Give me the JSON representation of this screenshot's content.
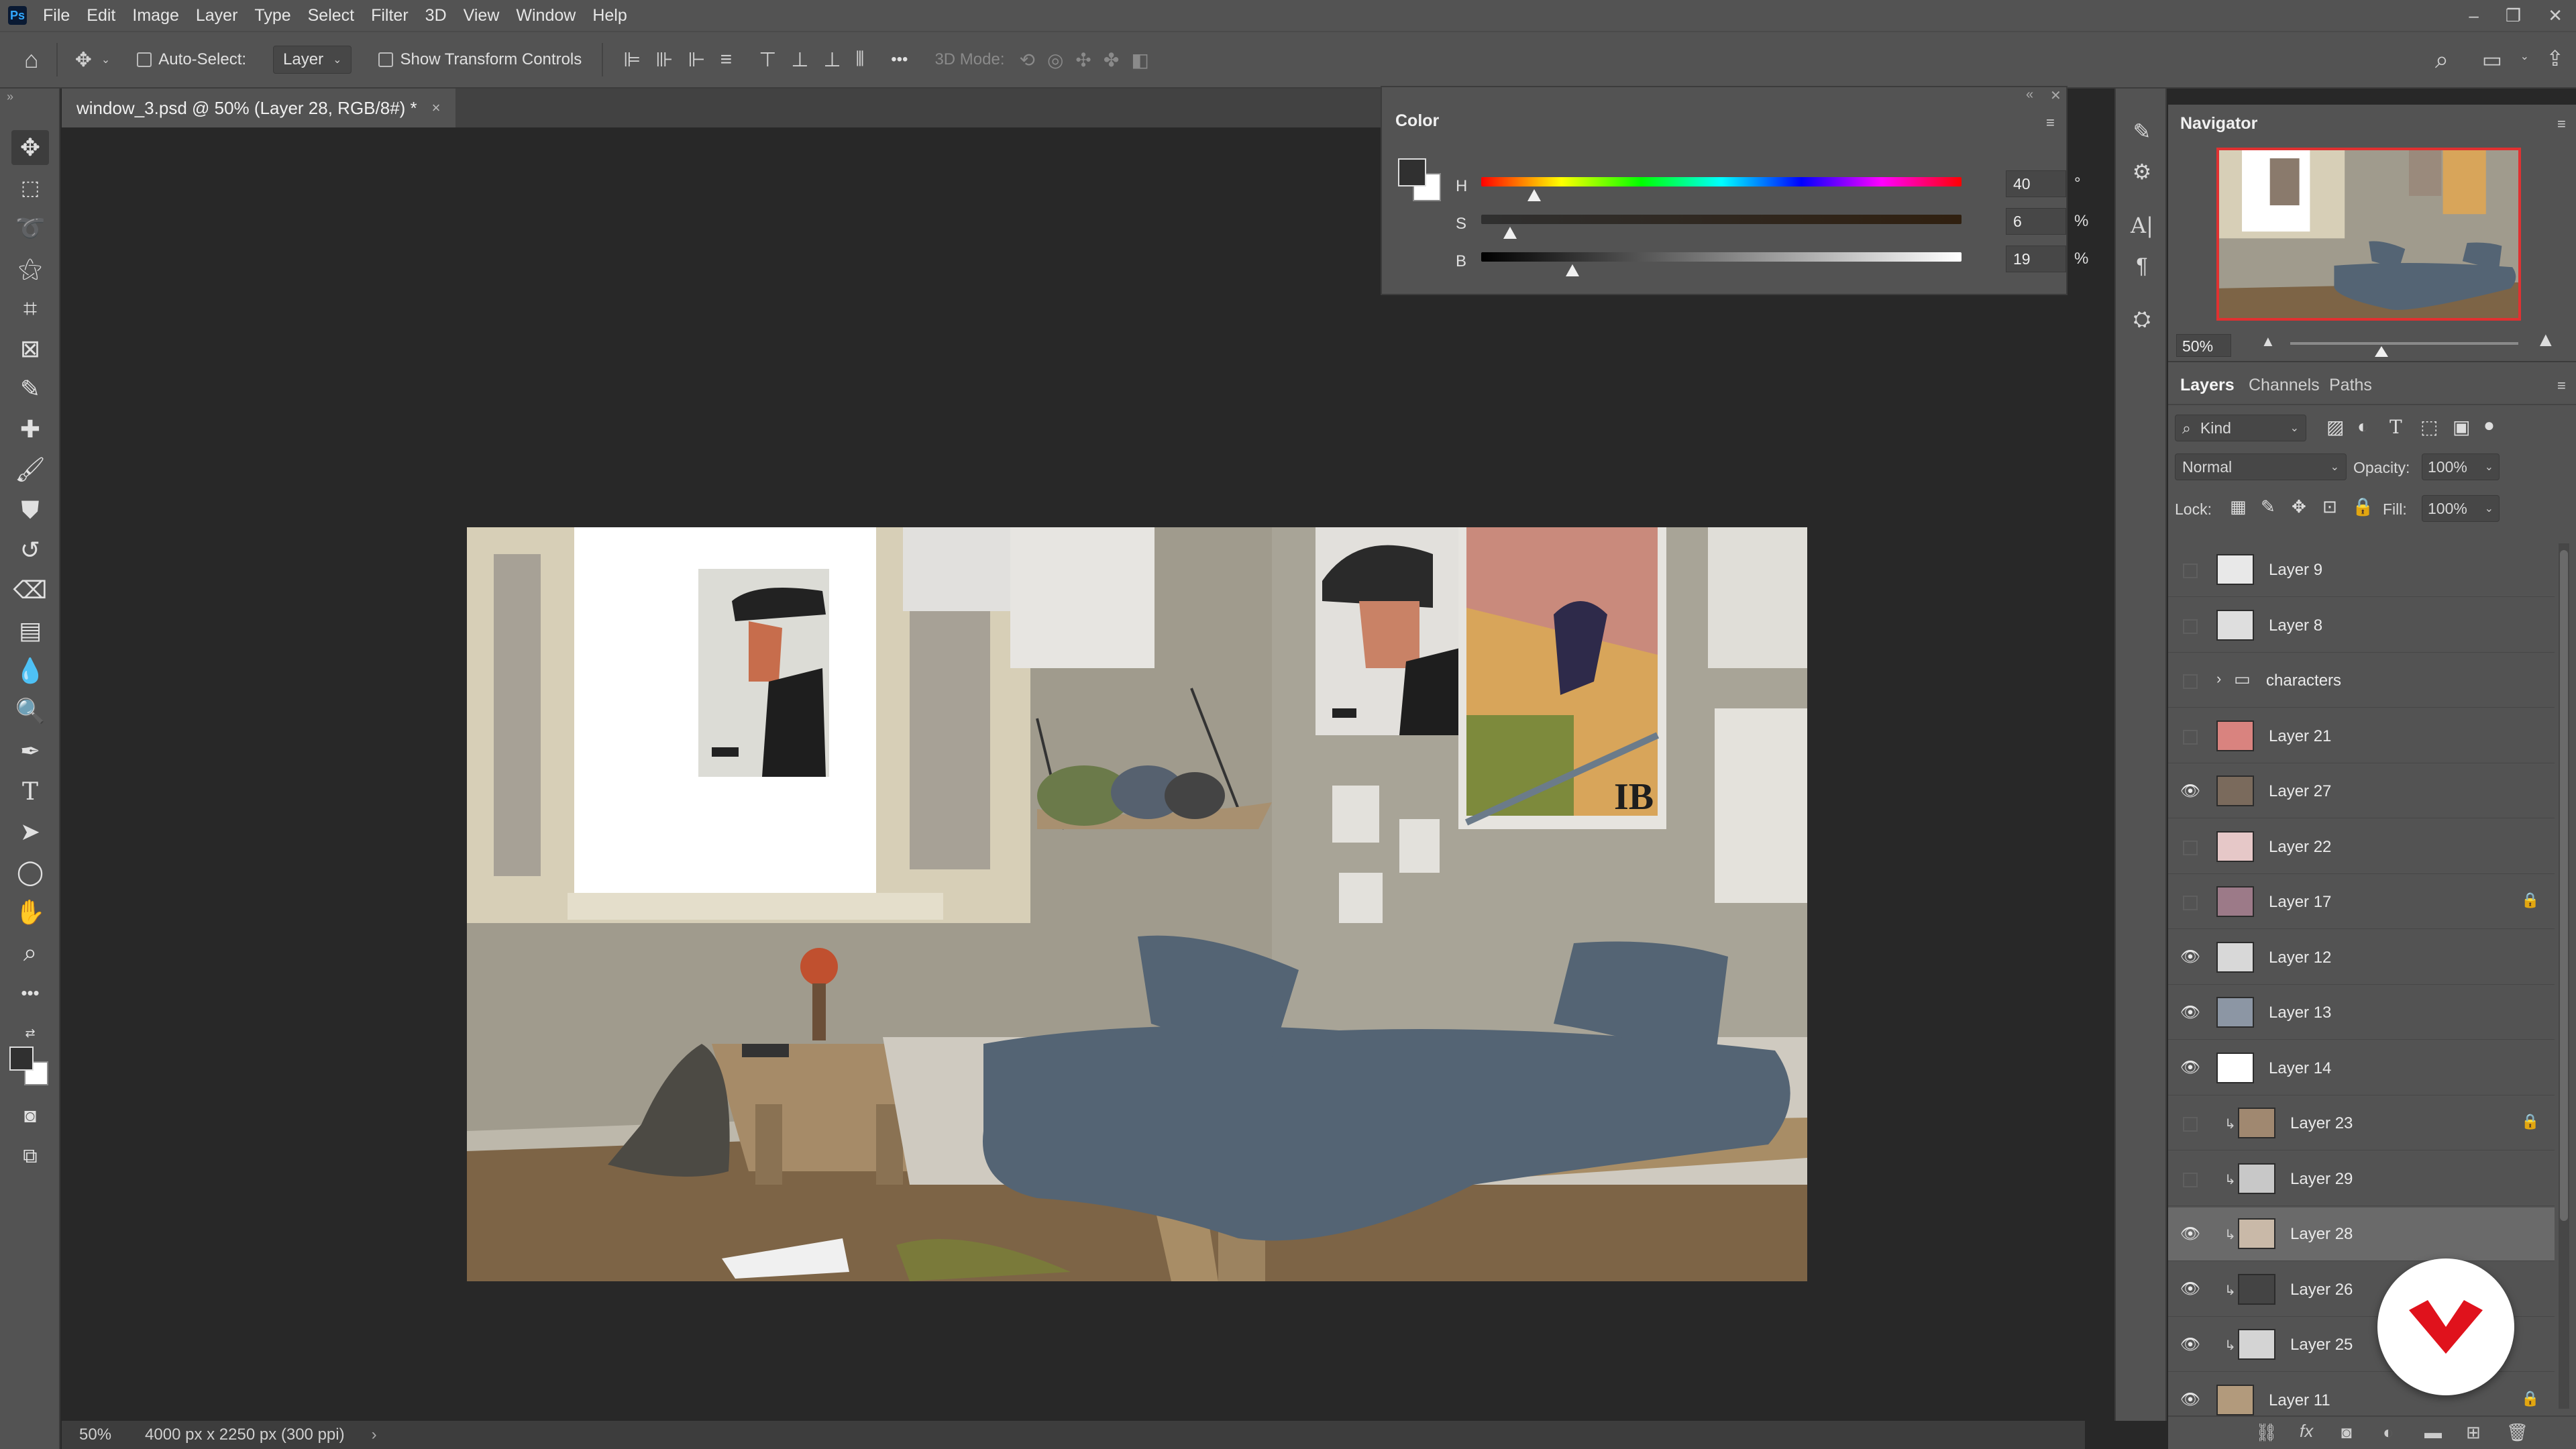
{
  "app": {
    "logo_text": "Ps"
  },
  "menu": [
    "File",
    "Edit",
    "Image",
    "Layer",
    "Type",
    "Select",
    "Filter",
    "3D",
    "View",
    "Window",
    "Help"
  ],
  "options": {
    "auto_select_label": "Auto-Select:",
    "auto_select_value": "Layer",
    "transform_label": "Show Transform Controls",
    "mode3d_label": "3D Mode:",
    "more_glyph": "•••"
  },
  "document": {
    "tab_title": "window_3.psd @ 50% (Layer 28, RGB/8#) *",
    "close_glyph": "×"
  },
  "status": {
    "zoom": "50%",
    "doc_size": "4000 px x 2250 px (300 ppi)",
    "arrow": "›"
  },
  "color_panel": {
    "title": "Color",
    "h": {
      "label": "H",
      "value": "40",
      "unit": "°",
      "fraction": 0.11
    },
    "s": {
      "label": "S",
      "value": "6",
      "unit": "%",
      "fraction": 0.06
    },
    "b": {
      "label": "B",
      "value": "19",
      "unit": "%",
      "fraction": 0.19
    },
    "foreground": "#303030",
    "background": "#ffffff"
  },
  "navigator": {
    "title": "Navigator",
    "zoom": "50%",
    "zoom_fraction": 0.4
  },
  "layers_panel": {
    "tabs": [
      "Layers",
      "Channels",
      "Paths"
    ],
    "filter_kind": "Kind",
    "blend_mode": "Normal",
    "opacity_label": "Opacity:",
    "opacity_value": "100%",
    "lock_label": "Lock:",
    "fill_label": "Fill:",
    "fill_value": "100%",
    "layers": [
      {
        "name": "Layer 9",
        "visible": false,
        "locked": false,
        "clipped": false,
        "group": false,
        "thumb": "#e8e8e8"
      },
      {
        "name": "Layer 8",
        "visible": false,
        "locked": false,
        "clipped": false,
        "group": false,
        "thumb": "#dedede"
      },
      {
        "name": "characters",
        "visible": false,
        "locked": false,
        "clipped": false,
        "group": true,
        "thumb": ""
      },
      {
        "name": "Layer 21",
        "visible": false,
        "locked": false,
        "clipped": false,
        "group": false,
        "thumb": "#d9837f"
      },
      {
        "name": "Layer 27",
        "visible": true,
        "locked": false,
        "clipped": false,
        "group": false,
        "thumb": "#7a6a5c"
      },
      {
        "name": "Layer 22",
        "visible": false,
        "locked": false,
        "clipped": false,
        "group": false,
        "thumb": "#e6c8c8"
      },
      {
        "name": "Layer 17",
        "visible": false,
        "locked": true,
        "clipped": false,
        "group": false,
        "thumb": "#9c7a88"
      },
      {
        "name": "Layer 12",
        "visible": true,
        "locked": false,
        "clipped": false,
        "group": false,
        "thumb": "#d8d8d8"
      },
      {
        "name": "Layer 13",
        "visible": true,
        "locked": false,
        "clipped": false,
        "group": false,
        "thumb": "#8c96a4"
      },
      {
        "name": "Layer 14",
        "visible": true,
        "locked": false,
        "clipped": false,
        "group": false,
        "thumb": "#ffffff"
      },
      {
        "name": "Layer 23",
        "visible": false,
        "locked": true,
        "clipped": true,
        "group": false,
        "thumb": "#a08870"
      },
      {
        "name": "Layer 29",
        "visible": false,
        "locked": false,
        "clipped": true,
        "group": false,
        "thumb": "#c8c8c8"
      },
      {
        "name": "Layer 28",
        "visible": true,
        "locked": false,
        "clipped": true,
        "group": false,
        "thumb": "#c9b9a8",
        "selected": true
      },
      {
        "name": "Layer 26",
        "visible": true,
        "locked": false,
        "clipped": true,
        "group": false,
        "thumb": "#444444"
      },
      {
        "name": "Layer 25",
        "visible": true,
        "locked": false,
        "clipped": true,
        "group": false,
        "thumb": "#d4d4d4"
      },
      {
        "name": "Layer 11",
        "visible": true,
        "locked": true,
        "clipped": false,
        "group": false,
        "thumb": "#b29a7c"
      }
    ]
  },
  "artwork": {
    "poster_text": "IB"
  },
  "colors": {
    "ui_panel": "#535353",
    "canvas_bg": "#282828",
    "selection_red": "#e03131",
    "badge_red": "#e0121c"
  }
}
